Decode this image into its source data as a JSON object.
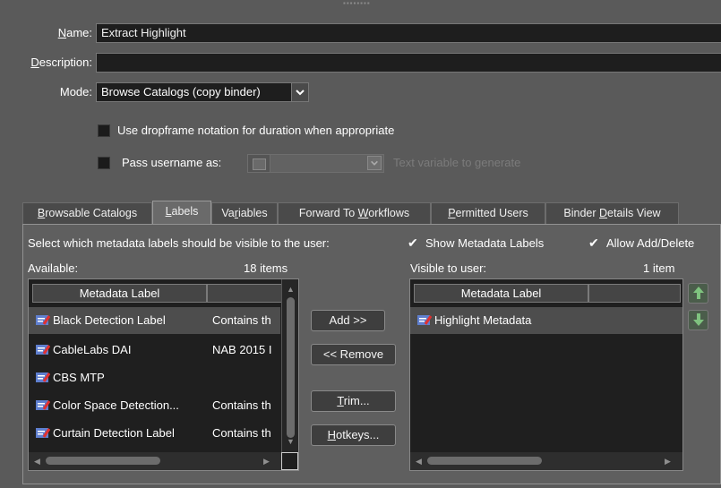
{
  "form": {
    "name_label": "Name:",
    "name_value": "Extract Highlight",
    "description_label": "Description:",
    "description_value": "",
    "mode_label": "Mode:",
    "mode_value": "Browse Catalogs (copy binder)",
    "dropframe_label": "Use dropframe notation for duration when appropriate",
    "dropframe_checked": false,
    "pass_username_label": "Pass username as:",
    "pass_username_checked": false,
    "text_variable_placeholder": "Text variable to generate"
  },
  "tabs": [
    {
      "label": "Browsable Catalogs",
      "active": false
    },
    {
      "label": "Labels",
      "active": true
    },
    {
      "label": "Variables",
      "active": false
    },
    {
      "label": "Forward To Workflows",
      "active": false
    },
    {
      "label": "Permitted Users",
      "active": false
    },
    {
      "label": "Binder Details View",
      "active": false
    }
  ],
  "labels_panel": {
    "instruction": "Select which metadata labels should be visible to the user:",
    "show_metadata_labels": "Show Metadata Labels",
    "show_metadata_checked": true,
    "allow_add_delete": "Allow Add/Delete",
    "allow_add_delete_checked": true,
    "available_label": "Available:",
    "available_count": "18 items",
    "visible_label": "Visible to user:",
    "visible_count": "1 item",
    "column_header": "Metadata Label",
    "available_items": [
      {
        "label": "Black Detection Label",
        "description": "Contains th"
      },
      {
        "label": "CableLabs DAI",
        "description": "NAB 2015 I"
      },
      {
        "label": "CBS MTP",
        "description": ""
      },
      {
        "label": "Color Space Detection...",
        "description": "Contains th"
      },
      {
        "label": "Curtain Detection Label",
        "description": "Contains th"
      }
    ],
    "visible_items": [
      {
        "label": "Highlight Metadata"
      }
    ],
    "buttons": {
      "add": "Add >>",
      "remove": "<< Remove",
      "trim": "Trim...",
      "hotkeys": "Hotkeys..."
    }
  },
  "colors": {
    "background": "#5a5a5a",
    "field_bg": "#1e1e1e",
    "panel_bg": "#5f5f5f",
    "selected_row": "#4d4d4d",
    "move_button_green": "#7fc37f"
  }
}
